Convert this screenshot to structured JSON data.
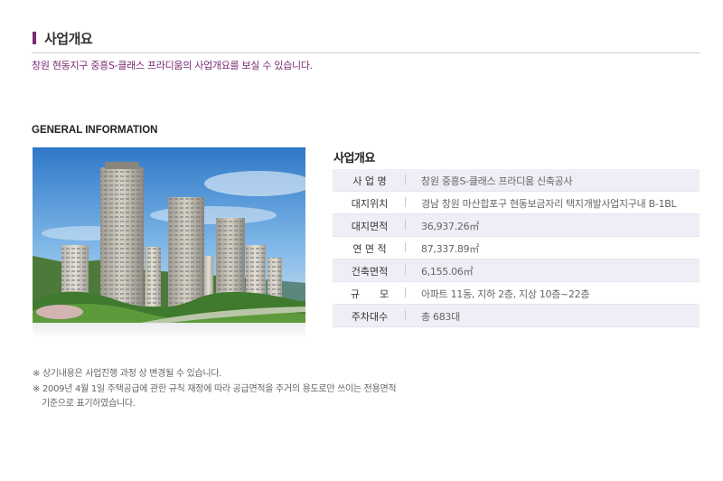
{
  "header": {
    "title": "사업개요",
    "subtitle": "창원 현동지구 중흥S-클래스 프라디움의 사업개요를 보실 수 있습니다.",
    "accent_color": "#7a2b74"
  },
  "section": {
    "label": "GENERAL INFORMATION"
  },
  "info": {
    "title": "사업개요",
    "rows": [
      {
        "label": "사 업 명",
        "value": "창원 중흥S-클래스 프라디움 신축공사"
      },
      {
        "label": "대지위치",
        "value": "경남 창원 마산합포구 현동보금자리 택지개발사업지구내 B-1BL"
      },
      {
        "label": "대지면적",
        "value": "36,937.26㎡"
      },
      {
        "label": "연 면 적",
        "value": "87,337.89㎡"
      },
      {
        "label": "건축면적",
        "value": "6,155.06㎡"
      },
      {
        "label": "규　　모",
        "value": "아파트 11동, 지하 2층, 지상 10층~22층"
      },
      {
        "label": "주차대수",
        "value": "총 683대"
      }
    ]
  },
  "notes": {
    "line1": "※ 상기내용은 사업진행 과정 상 변경될 수 있습니다.",
    "line2": "※ 2009년 4월 1일 주택공급에 관한 규칙 재정에 따라 공급면적을 주거의 용도로만 쓰이는 전용면적",
    "line3": "기준으로 표기하였습니다."
  }
}
